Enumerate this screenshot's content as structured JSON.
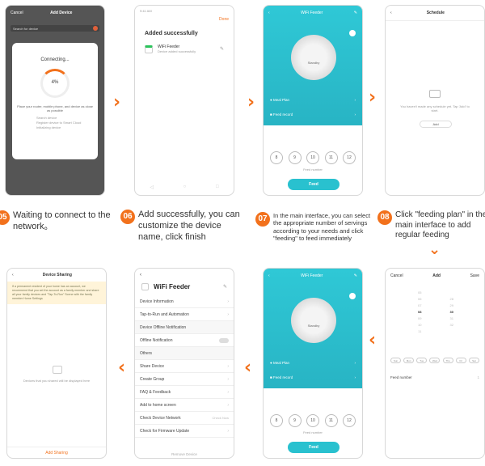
{
  "steps": {
    "s05": {
      "num": "05",
      "text": "Waiting to connect to the network。"
    },
    "s06": {
      "num": "06",
      "text": "Add successfully, you can customize the device name, click finish"
    },
    "s07": {
      "num": "07",
      "text": "In the main interface, you can select the appropriate number of servings according to your needs and click \"feeding\" to feed immediately"
    },
    "s08": {
      "num": "08",
      "text": "Click \"feeding plan\" in the main interface to add regular feeding"
    }
  },
  "p1": {
    "cancel": "Cancel",
    "title": "Add Device",
    "bar": "Search for device",
    "dialog_title": "Connecting...",
    "percent": "4%",
    "msg": "Place your router, mobile phone, and device as close as possible",
    "b1": "Search device",
    "b2": "Register device to Smart Cloud",
    "b3": "Initializing device"
  },
  "p2": {
    "status": "9:41 AM",
    "done": "Done",
    "title": "Added successfully",
    "device": "WiFi Feeder",
    "sub": "Device added successfully"
  },
  "p3": {
    "title": "WiFi Feeder",
    "standby": "Standby",
    "meal": "Meal Plan",
    "record": "Feed record",
    "wheel": [
      "8",
      "9",
      "10",
      "11",
      "12"
    ],
    "fnum": "Feed number",
    "feed": "Feed"
  },
  "p4": {
    "title": "Schedule",
    "empty": "You haven't made any schedule yet. Tap 'Add' to start.",
    "add": "Add"
  },
  "p5": {
    "title": "Device Sharing",
    "notice": "If a permanent resident of your home has an account, we recommend that you set the account as a family member and share all your family devices and \"Tap-To-Run\" Scene with the family member Home Settings",
    "empty": "Devices that you shared will be displayed here",
    "btn": "Add Sharing"
  },
  "p6": {
    "title": "WiFi Feeder",
    "items": [
      "Device Information",
      "Tap-to-Run and Automation",
      "Device Offline Notification",
      "Offline Notification",
      "Others",
      "Share Device",
      "Create Group",
      "FAQ & Feedback",
      "Add to home screen",
      "Check Device Network",
      "Check for Firmware Update"
    ],
    "check_now": "Check Now",
    "remove": "Remove Device"
  },
  "p7": {
    "title": "WiFi Feeder",
    "standby": "Standby",
    "meal": "Meal Plan",
    "record": "Feed record",
    "wheel": [
      "8",
      "9",
      "10",
      "11",
      "12"
    ],
    "fnum": "Feed number",
    "feed": "Feed"
  },
  "p8": {
    "cancel": "Cancel",
    "title": "Add",
    "save": "Save",
    "hours": [
      "05",
      "06",
      "07",
      "08",
      "09",
      "10",
      "11"
    ],
    "mins": [
      "28",
      "29",
      "30",
      "31",
      "32"
    ],
    "days": [
      "Sun",
      "Mon",
      "Tue",
      "Wed",
      "Thu",
      "Fri",
      "Sat"
    ],
    "fnum": "Feed number",
    "fval": "1"
  },
  "arrows": {
    "right": "›",
    "left": "‹",
    "down": "⌄"
  }
}
